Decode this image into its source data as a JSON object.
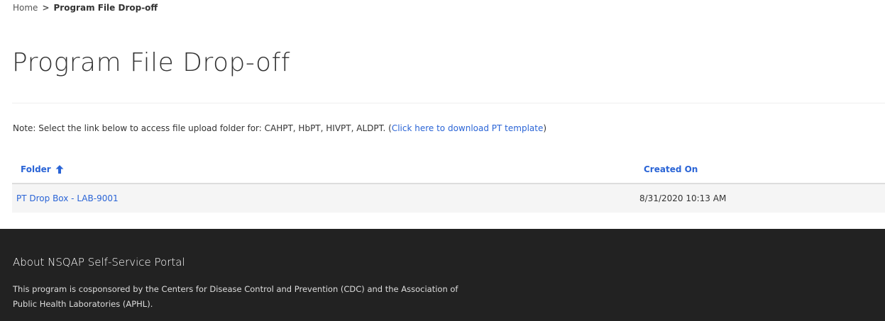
{
  "breadcrumb": {
    "home": "Home",
    "separator": ">",
    "current": "Program File Drop-off"
  },
  "page": {
    "title": "Program File Drop-off"
  },
  "note": {
    "prefix": "Note:  Select the link below to access file upload folder for: CAHPT, HbPT, HIVPT, ALDPT. (",
    "link": "Click here to download PT template",
    "suffix": ")"
  },
  "grid": {
    "columns": [
      {
        "label": "Folder",
        "sort_icon": "arrow-up-icon"
      },
      {
        "label": "Created On"
      }
    ],
    "rows": [
      {
        "folder": "PT Drop Box - LAB-9001",
        "created_on": "8/31/2020 10:13 AM"
      }
    ]
  },
  "footer": {
    "heading": "About NSQAP Self-Service Portal",
    "text": "This program is cosponsored by the Centers for Disease Control and Prevention (CDC) and the Association of Public Health Laboratories (APHL)."
  },
  "colors": {
    "link": "#2a64d6",
    "footer_bg": "#222222",
    "row_bg": "#f5f5f5"
  }
}
